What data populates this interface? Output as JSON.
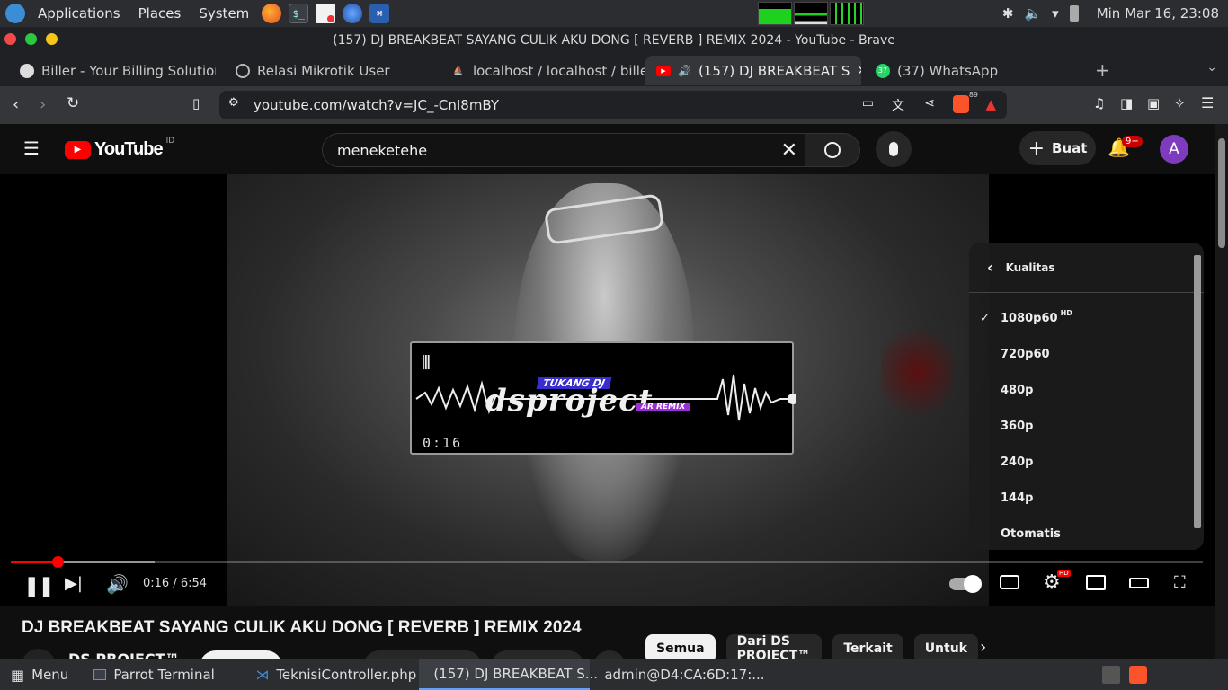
{
  "topbar": {
    "menus": [
      "Applications",
      "Places",
      "System"
    ],
    "clock": "Min Mar 16, 23:08"
  },
  "window": {
    "title": "(157) DJ BREAKBEAT SAYANG CULIK AKU DONG [ REVERB ] REMIX 2024 - YouTube - Brave"
  },
  "tabs": [
    {
      "label": "Biller - Your Billing Solution"
    },
    {
      "label": "Relasi Mikrotik User"
    },
    {
      "label": "localhost / localhost / biller /"
    },
    {
      "label": "(157) DJ BREAKBEAT S"
    },
    {
      "label": "(37) WhatsApp",
      "badge": "37"
    }
  ],
  "address": {
    "url": "youtube.com/watch?v=JC_-CnI8mBY",
    "shield_count": "89"
  },
  "youtube": {
    "logo_text": "YouTube",
    "region": "ID",
    "search_value": "meneketehe",
    "create_label": "Buat",
    "notif_badge": "9+",
    "avatar_letter": "A"
  },
  "player": {
    "overlay_brand_top": "TUKANG DJ",
    "overlay_brand": "dsproject",
    "overlay_brand_sub": "AR REMIX",
    "overlay_time": "0:16",
    "time_display": "0:16 / 6:54",
    "progress": 0.039,
    "buffered": 0.121,
    "settings_badge": "HD"
  },
  "quality_menu": {
    "title": "Kualitas",
    "items": [
      "1080p60",
      "720p60",
      "480p",
      "360p",
      "240p",
      "144p",
      "Otomatis"
    ],
    "hd_tag": "HD",
    "selected": "1080p60"
  },
  "video_info": {
    "title": "DJ BREAKBEAT SAYANG CULIK AKU DONG [ REVERB ] REMIX 2024",
    "channel": "DS PROJECT™"
  },
  "chips": [
    "Semua",
    "Dari DS PROJECT™",
    "Terkait",
    "Untuk"
  ],
  "taskbar": {
    "menu_label": "Menu",
    "tasks": [
      "Parrot Terminal",
      "TeknisiController.php ...",
      "(157) DJ BREAKBEAT S...",
      "admin@D4:CA:6D:17:..."
    ]
  }
}
